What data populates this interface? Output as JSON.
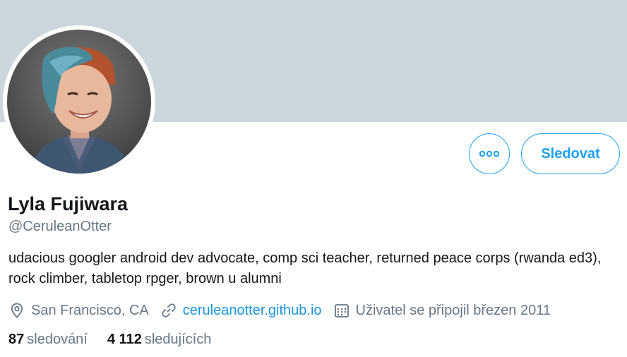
{
  "colors": {
    "banner": "#ccd6dd",
    "accent": "#1da1f2",
    "link": "#1b95e0",
    "text_primary": "#14171a",
    "text_secondary": "#657786"
  },
  "profile": {
    "name": "Lyla Fujiwara",
    "handle": "@CeruleanOtter",
    "bio": "udacious googler android dev advocate, comp sci teacher, returned peace corps (rwanda ed3), rock climber, tabletop rpger, brown u alumni",
    "location": "San Francisco, CA",
    "website": "ceruleanotter.github.io",
    "joined": "Uživatel se připojil březen 2011",
    "avatar_icon": "profile-photo"
  },
  "actions": {
    "more_icon": "more-options-icon",
    "follow_label": "Sledovat"
  },
  "icons": {
    "location": "location-pin-icon",
    "website": "link-icon",
    "joined": "calendar-icon"
  },
  "stats": {
    "following_count": "87",
    "following_label": "sledování",
    "followers_count": "4 112",
    "followers_label": "sledujících"
  }
}
